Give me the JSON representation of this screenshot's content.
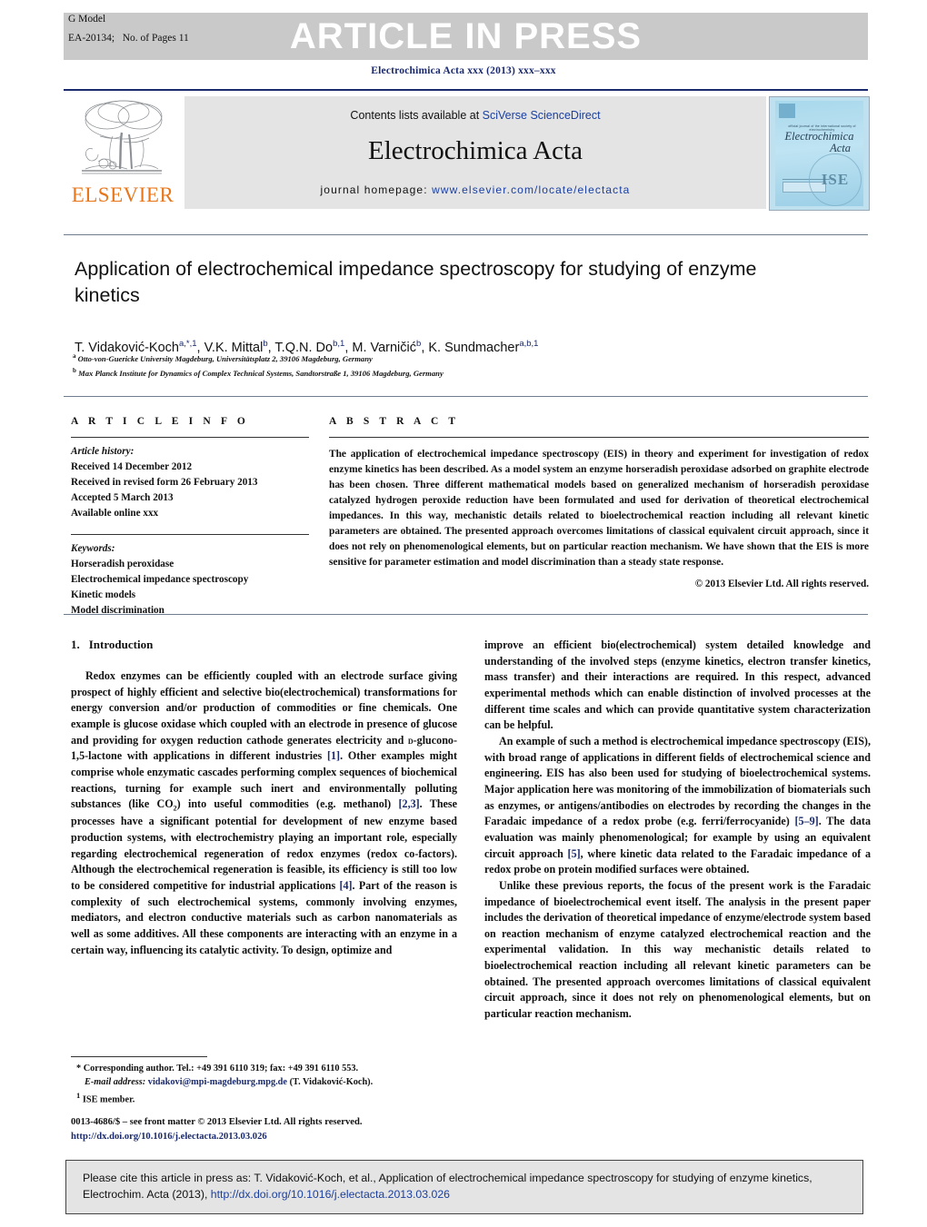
{
  "header": {
    "g_model_label": "G Model",
    "article_id": "EA-20134;",
    "pages_note": "No. of Pages 11",
    "article_in_press": "ARTICLE IN PRESS",
    "journal_reference": "Electrochimica Acta xxx (2013) xxx–xxx"
  },
  "masthead": {
    "publisher_name": "ELSEVIER",
    "contents_prefix": "Contents lists available at ",
    "contents_link": "SciVerse ScienceDirect",
    "journal_title": "Electrochimica Acta",
    "homepage_prefix": "journal homepage: ",
    "homepage_url": "www.elsevier.com/locate/electacta",
    "cover": {
      "society_line": "official journal of the international society of electrochemistry",
      "title_line1": "Electrochimica",
      "title_line2": "Acta",
      "badge": "ISE"
    }
  },
  "article": {
    "title": "Application of electrochemical impedance spectroscopy for studying of enzyme kinetics",
    "authors_html": "T. Vidaković-Koch<sup>a,*,1</sup>, V.K. Mittal<sup>b</sup>, T.Q.N. Do<sup>b,1</sup>, M. Varničić<sup>b</sup>, K. Sundmacher<sup>a,b,1</sup>",
    "affiliations": [
      {
        "marker": "a",
        "text": "Otto-von-Guericke University Magdeburg, Universitätsplatz 2, 39106 Magdeburg, Germany"
      },
      {
        "marker": "b",
        "text": "Max Planck Institute for Dynamics of Complex Technical Systems, Sandtorstraße 1, 39106 Magdeburg, Germany"
      }
    ]
  },
  "article_info": {
    "heading": "A R T I C L E   I N F O",
    "history_label": "Article history:",
    "history": [
      "Received 14 December 2012",
      "Received in revised form 26 February 2013",
      "Accepted 5 March 2013",
      "Available online xxx"
    ],
    "keywords_label": "Keywords:",
    "keywords": [
      "Horseradish peroxidase",
      "Electrochemical impedance spectroscopy",
      "Kinetic models",
      "Model discrimination"
    ]
  },
  "abstract": {
    "heading": "A B S T R A C T",
    "text": "The application of electrochemical impedance spectroscopy (EIS) in theory and experiment for investigation of redox enzyme kinetics has been described. As a model system an enzyme horseradish peroxidase adsorbed on graphite electrode has been chosen. Three different mathematical models based on generalized mechanism of horseradish peroxidase catalyzed hydrogen peroxide reduction have been formulated and used for derivation of theoretical electrochemical impedances. In this way, mechanistic details related to bioelectrochemical reaction including all relevant kinetic parameters are obtained. The presented approach overcomes limitations of classical equivalent circuit approach, since it does not rely on phenomenological elements, but on particular reaction mechanism. We have shown that the EIS is more sensitive for parameter estimation and model discrimination than a steady state response.",
    "copyright": "© 2013 Elsevier Ltd. All rights reserved."
  },
  "body": {
    "section_number": "1.",
    "section_title": "Introduction",
    "left_paragraphs": [
      "Redox enzymes can be efficiently coupled with an electrode surface giving prospect of highly efficient and selective bio(electrochemical) transformations for energy conversion and/or production of commodities or fine chemicals. One example is glucose oxidase which coupled with an electrode in presence of glucose and providing for oxygen reduction cathode generates electricity and D-glucono-1,5-lactone with applications in different industries [1]. Other examples might comprise whole enzymatic cascades performing complex sequences of biochemical reactions, turning for example such inert and environmentally polluting substances (like CO2) into useful commodities (e.g. methanol) [2,3]. These processes have a significant potential for development of new enzyme based production systems, with electrochemistry playing an important role, especially regarding electrochemical regeneration of redox enzymes (redox co-factors). Although the electrochemical regeneration is feasible, its efficiency is still too low to be considered competitive for industrial applications [4]. Part of the reason is complexity of such electrochemical systems, commonly involving enzymes, mediators, and electron conductive materials such as carbon nanomaterials as well as some additives. All these components are interacting with an enzyme in a certain way, influencing its catalytic activity. To design, optimize and"
    ],
    "right_paragraphs": [
      "improve an efficient bio(electrochemical) system detailed knowledge and understanding of the involved steps (enzyme kinetics, electron transfer kinetics, mass transfer) and their interactions are required. In this respect, advanced experimental methods which can enable distinction of involved processes at the different time scales and which can provide quantitative system characterization can be helpful.",
      "An example of such a method is electrochemical impedance spectroscopy (EIS), with broad range of applications in different fields of electrochemical science and engineering. EIS has also been used for studying of bioelectrochemical systems. Major application here was monitoring of the immobilization of biomaterials such as enzymes, or antigens/antibodies on electrodes by recording the changes in the Faradaic impedance of a redox probe (e.g. ferri/ferrocyanide) [5–9]. The data evaluation was mainly phenomenological; for example by using an equivalent circuit approach [5], where kinetic data related to the Faradaic impedance of a redox probe on protein modified surfaces were obtained.",
      "Unlike these previous reports, the focus of the present work is the Faradaic impedance of bioelectrochemical event itself. The analysis in the present paper includes the derivation of theoretical impedance of enzyme/electrode system based on reaction mechanism of enzyme catalyzed electrochemical reaction and the experimental validation. In this way mechanistic details related to bioelectrochemical reaction including all relevant kinetic parameters can be obtained. The presented approach overcomes limitations of classical equivalent circuit approach, since it does not rely on phenomenological elements, but on particular reaction mechanism."
    ]
  },
  "footnotes": {
    "corresponding": "* Corresponding author. Tel.: +49 391 6110 319; fax: +49 391 6110 553.",
    "email_label": "E-mail address:",
    "email": "vidakovi@mpi-magdeburg.mpg.de",
    "email_suffix": "(T. Vidaković-Koch).",
    "ise_marker": "1",
    "ise_member": "ISE member.",
    "issn_line": "0013-4686/$ – see front matter © 2013 Elsevier Ltd. All rights reserved.",
    "doi_line": "http://dx.doi.org/10.1016/j.electacta.2013.03.026"
  },
  "cite_box": {
    "prefix": "Please cite this article in press as: T. Vidaković-Koch, et al., Application of electrochemical impedance spectroscopy for studying of enzyme kinetics, Electrochim. Acta (2013), ",
    "doi": "http://dx.doi.org/10.1016/j.electacta.2013.03.026"
  },
  "colors": {
    "link_blue": "#1a3fa0",
    "ref_blue": "#1a2a6c",
    "elsevier_orange": "#E8761A",
    "band_gray": "#c9c9c9",
    "panel_gray": "#e4e4e4"
  }
}
